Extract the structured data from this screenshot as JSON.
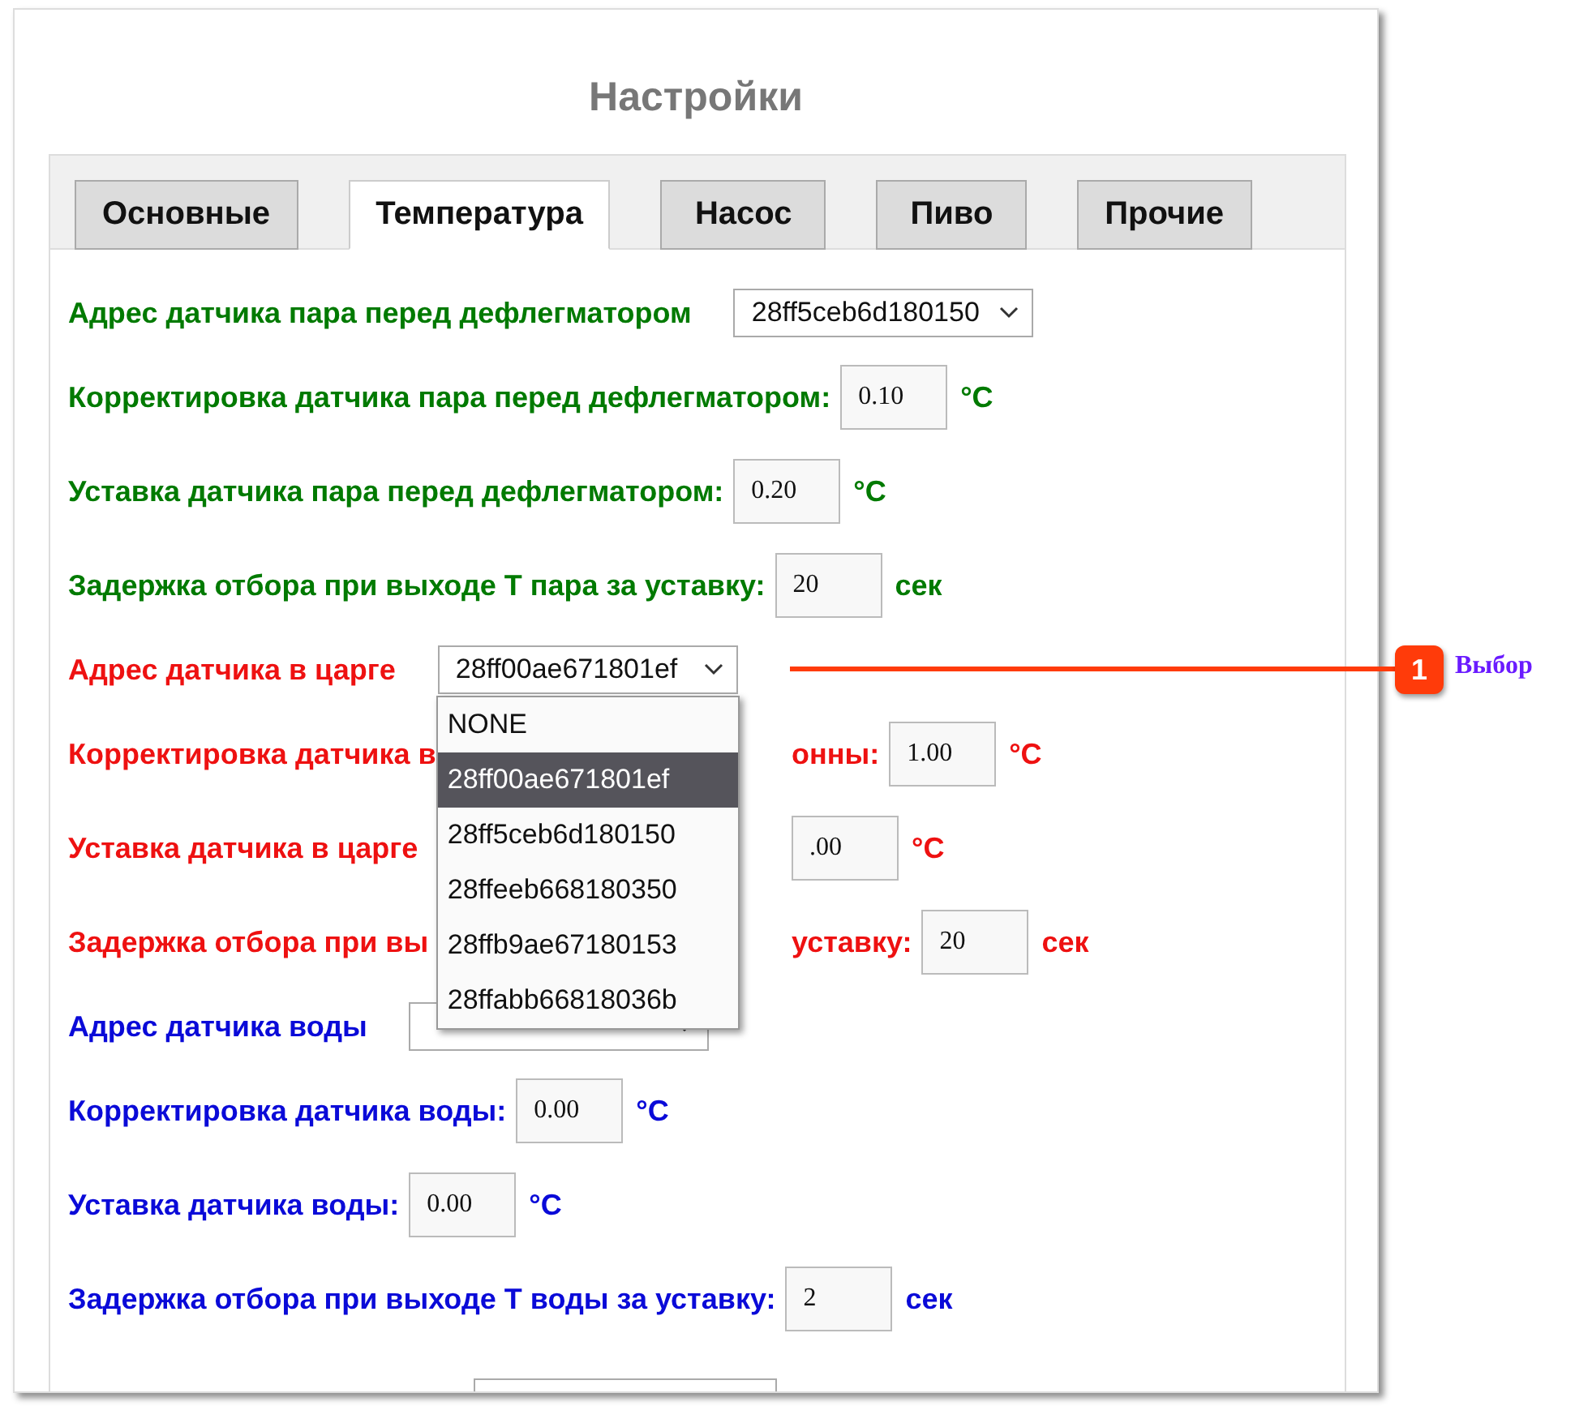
{
  "title": "Настройки",
  "tabs": [
    {
      "label": "Основные",
      "selected": false
    },
    {
      "label": "Температура",
      "selected": true
    },
    {
      "label": "Насос",
      "selected": false
    },
    {
      "label": "Пиво",
      "selected": false
    },
    {
      "label": "Прочие",
      "selected": false
    }
  ],
  "rows": [
    {
      "kind": "select",
      "color": "#007a00",
      "label": "Адрес датчика пара перед дефлегматором",
      "value": "28ff5ceb6d180150"
    },
    {
      "kind": "number",
      "color": "#007a00",
      "label": "Корректировка датчика пара перед дефлегматором:",
      "value": "0.10",
      "unit": "°C"
    },
    {
      "kind": "number",
      "color": "#007a00",
      "label": "Уставка датчика пара перед дефлегматором:",
      "value": "0.20",
      "unit": "°C"
    },
    {
      "kind": "number",
      "color": "#007a00",
      "label": "Задержка отбора при выходе Т пара за уставку:",
      "value": "20",
      "unit": "сек"
    },
    {
      "kind": "select",
      "color": "#ee1111",
      "label": "Адрес датчика в царге",
      "value": "28ff00ae671801ef",
      "open": true,
      "options": [
        {
          "label": "NONE",
          "selected": false
        },
        {
          "label": "28ff00ae671801ef",
          "selected": true
        },
        {
          "label": "28ff5ceb6d180150",
          "selected": false
        },
        {
          "label": "28ffeeb668180350",
          "selected": false
        },
        {
          "label": "28ffb9ae67180153",
          "selected": false
        },
        {
          "label": "28ffabb66818036b",
          "selected": false
        }
      ]
    },
    {
      "kind": "covered",
      "color": "#ee1111",
      "label": "Корректировка датчика в",
      "label_tail": "онны:",
      "value": "1.00",
      "unit": "°C"
    },
    {
      "kind": "covered",
      "color": "#ee1111",
      "label": "Уставка датчика в царге",
      "value": ".00",
      "unit": "°C"
    },
    {
      "kind": "covered",
      "color": "#ee1111",
      "label": "Задержка отбора при вы",
      "label_tail": "уставку:",
      "value": "20",
      "unit": "сек"
    },
    {
      "kind": "select",
      "color": "#0a0ad8",
      "label": "Адрес датчика воды"
    },
    {
      "kind": "number",
      "color": "#0a0ad8",
      "label": "Корректировка датчика воды:",
      "value": "0.00",
      "unit": "°C"
    },
    {
      "kind": "number",
      "color": "#0a0ad8",
      "label": "Уставка датчика воды:",
      "value": "0.00",
      "unit": "°C"
    },
    {
      "kind": "number",
      "color": "#0a0ad8",
      "label": "Задержка отбора при выходе Т воды за уставку:",
      "value": "2",
      "unit": "сек"
    },
    {
      "kind": "cut"
    }
  ],
  "callout": {
    "number": "1",
    "text": "Выбор"
  }
}
